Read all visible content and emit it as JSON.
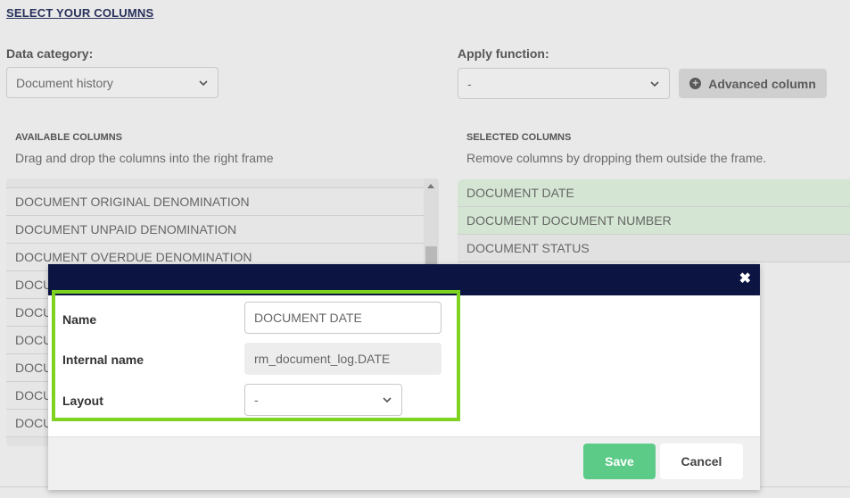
{
  "page": {
    "title": "SELECT YOUR COLUMNS"
  },
  "data_category": {
    "label": "Data category:",
    "value": "Document history"
  },
  "apply_function": {
    "label": "Apply function:",
    "value": "-"
  },
  "advanced_button": {
    "label": "Advanced column",
    "icon": "plus-circle-icon"
  },
  "available": {
    "heading": "AVAILABLE COLUMNS",
    "subtitle": "Drag and drop the columns into the right frame",
    "items": [
      "DOCUMENT ORIGINAL DENOMINATION",
      "DOCUMENT UNPAID DENOMINATION",
      "DOCUMENT OVERDUE DENOMINATION",
      "DOCU",
      "DOCU",
      "DOCU",
      "DOCU",
      "DOCU",
      "DOCU"
    ]
  },
  "selected": {
    "heading": "SELECTED COLUMNS",
    "subtitle": "Remove columns by dropping them outside the frame.",
    "items": [
      "DOCUMENT DATE",
      "DOCUMENT DOCUMENT NUMBER",
      "DOCUMENT STATUS"
    ]
  },
  "modal": {
    "close_icon": "close-icon",
    "name_label": "Name",
    "name_value": "DOCUMENT DATE",
    "internal_label": "Internal name",
    "internal_value": "rm_document_log.DATE",
    "layout_label": "Layout",
    "layout_value": "-",
    "save_label": "Save",
    "cancel_label": "Cancel"
  },
  "colors": {
    "modal_header": "#0c1442",
    "highlight": "#7ed321",
    "save": "#5ccb87",
    "selected_green": "#d4e6d3"
  }
}
